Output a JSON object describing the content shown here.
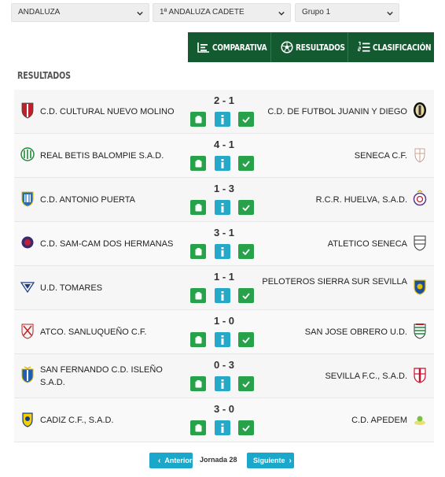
{
  "filters": {
    "region": "ANDALUZA",
    "competition": "1ª ANDALUZA CADETE",
    "group": "Grupo 1"
  },
  "tabs": [
    {
      "label": "COMPARATIVA",
      "icon": "bar-chart-icon"
    },
    {
      "label": "RESULTADOS",
      "icon": "soccer-ball-icon"
    },
    {
      "label": "CLASIFICACIÓN",
      "icon": "ranking-list-icon"
    }
  ],
  "section_title": "RESULTADOS",
  "matches": [
    {
      "home": "C.D. CULTURAL NUEVO MOLINO",
      "score": "2 - 1",
      "away": "C.D. DE FUTBOL JUANIN Y DIEGO"
    },
    {
      "home": "REAL BETIS BALOMPIE S.A.D.",
      "score": "4 - 1",
      "away": "SENECA C.F."
    },
    {
      "home": "C.D. ANTONIO PUERTA",
      "score": "1 - 3",
      "away": "R.C.R. HUELVA, S.A.D."
    },
    {
      "home": "C.D. SAM-CAM DOS HERMANAS",
      "score": "3 - 1",
      "away": "ATLETICO SENECA"
    },
    {
      "home": "U.D. TOMARES",
      "score": "1 - 1",
      "away": "PELOTEROS SIERRA SUR SEVILLA"
    },
    {
      "home": "ATCO. SANLUQUEÑO C.F.",
      "score": "1 - 0",
      "away": "SAN JOSE OBRERO U.D."
    },
    {
      "home": "SAN FERNANDO C.D. ISLEÑO S.A.D.",
      "score": "0 - 3",
      "away": "SEVILLA F.C., S.A.D."
    },
    {
      "home": "CADIZ C.F., S.A.D.",
      "score": "3 - 0",
      "away": "C.D. APEDEM"
    }
  ],
  "pager": {
    "prev_label": "Anterior",
    "current": "Jornada 28",
    "next_label": "Siguiente"
  },
  "colors": {
    "tab_bg": "#145a31",
    "green_button": "#27a24a",
    "info_button": "#26a9c9",
    "pager_button": "#1aa7c9"
  }
}
